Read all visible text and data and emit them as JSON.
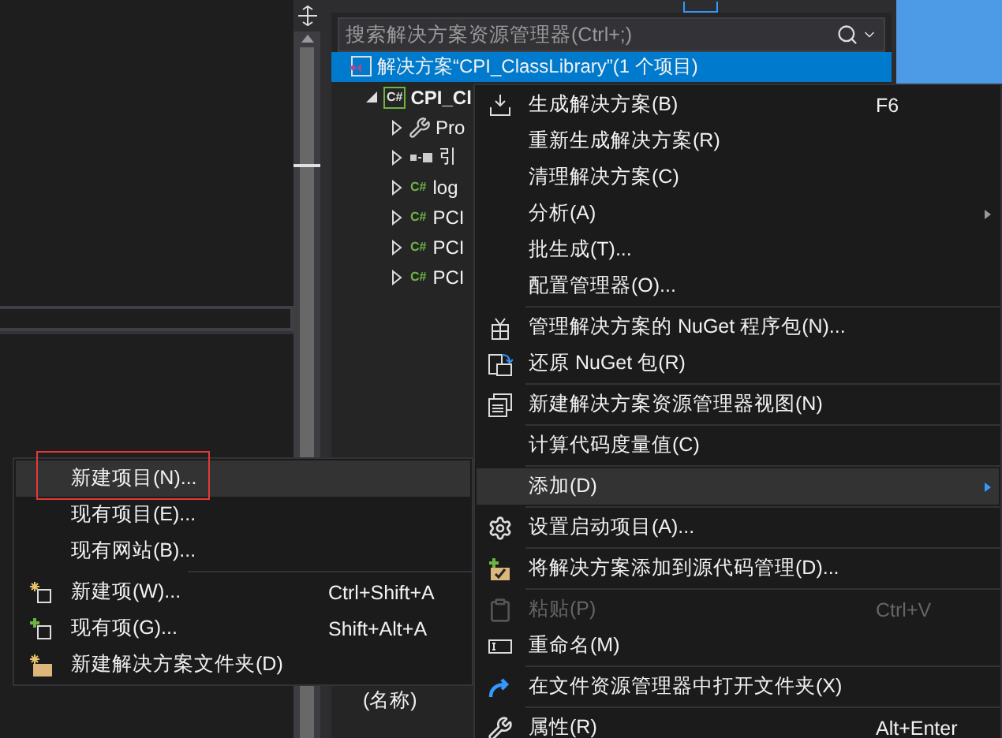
{
  "search": {
    "placeholder": "搜索解决方案资源管理器(Ctrl+;)"
  },
  "tree": [
    {
      "kind": "solution",
      "label": "解决方案“CPI_ClassLibrary”(1 个项目)",
      "selected": true,
      "children": [
        {
          "kind": "project",
          "badge": "C#",
          "label": "CPI_Cl",
          "selected": false,
          "expanded": true,
          "children": [
            {
              "kind": "properties",
              "label": "Pro",
              "selected": false,
              "expanded": false
            },
            {
              "kind": "references",
              "label": "引",
              "selected": false,
              "expanded": false
            },
            {
              "kind": "file",
              "badge": "C#",
              "label": "log",
              "selected": false,
              "expanded": false
            },
            {
              "kind": "file",
              "badge": "C#",
              "label": "PCI",
              "selected": false,
              "expanded": false
            },
            {
              "kind": "file",
              "badge": "C#",
              "label": "PCI",
              "selected": false,
              "expanded": false
            },
            {
              "kind": "file",
              "badge": "C#",
              "label": "PCI",
              "selected": false,
              "expanded": false
            }
          ]
        }
      ]
    }
  ],
  "properties": {
    "rows": [
      {
        "name": "(名称)"
      }
    ]
  },
  "context_menu": {
    "items": [
      {
        "kind": "item",
        "label": "生成解决方案(B)",
        "shortcut": "F6",
        "selected": false,
        "disabled": false,
        "submenu": false
      },
      {
        "kind": "item",
        "label": "重新生成解决方案(R)",
        "selected": false,
        "disabled": false,
        "submenu": false
      },
      {
        "kind": "item",
        "label": "清理解决方案(C)",
        "selected": false,
        "disabled": false,
        "submenu": false
      },
      {
        "kind": "item",
        "label": "分析(A)",
        "selected": false,
        "disabled": false,
        "submenu": true
      },
      {
        "kind": "item",
        "label": "批生成(T)...",
        "selected": false,
        "disabled": false,
        "submenu": false
      },
      {
        "kind": "item",
        "label": "配置管理器(O)...",
        "selected": false,
        "disabled": false,
        "submenu": false
      },
      {
        "kind": "separator"
      },
      {
        "kind": "item",
        "label": "管理解决方案的 NuGet 程序包(N)...",
        "selected": false,
        "disabled": false,
        "submenu": false
      },
      {
        "kind": "item",
        "label": "还原 NuGet 包(R)",
        "selected": false,
        "disabled": false,
        "submenu": false
      },
      {
        "kind": "separator"
      },
      {
        "kind": "item",
        "label": "新建解决方案资源管理器视图(N)",
        "selected": false,
        "disabled": false,
        "submenu": false
      },
      {
        "kind": "separator"
      },
      {
        "kind": "item",
        "label": "计算代码度量值(C)",
        "selected": false,
        "disabled": false,
        "submenu": false
      },
      {
        "kind": "separator"
      },
      {
        "kind": "item",
        "label": "添加(D)",
        "selected": true,
        "disabled": false,
        "submenu": true
      },
      {
        "kind": "separator"
      },
      {
        "kind": "item",
        "label": "设置启动项目(A)...",
        "selected": false,
        "disabled": false,
        "submenu": false
      },
      {
        "kind": "separator"
      },
      {
        "kind": "item",
        "label": "将解决方案添加到源代码管理(D)...",
        "selected": false,
        "disabled": false,
        "submenu": false
      },
      {
        "kind": "separator"
      },
      {
        "kind": "item",
        "label": "粘贴(P)",
        "shortcut": "Ctrl+V",
        "selected": false,
        "disabled": true,
        "submenu": false
      },
      {
        "kind": "item",
        "label": "重命名(M)",
        "selected": false,
        "disabled": false,
        "submenu": false
      },
      {
        "kind": "separator"
      },
      {
        "kind": "item",
        "label": "在文件资源管理器中打开文件夹(X)",
        "selected": false,
        "disabled": false,
        "submenu": false
      },
      {
        "kind": "separator"
      },
      {
        "kind": "item",
        "label": "属性(R)",
        "shortcut": "Alt+Enter",
        "selected": false,
        "disabled": false,
        "submenu": false
      }
    ]
  },
  "add_submenu": {
    "items": [
      {
        "kind": "item",
        "label": "新建项目(N)...",
        "selected": true,
        "disabled": false,
        "annotated": true
      },
      {
        "kind": "item",
        "label": "现有项目(E)...",
        "selected": false,
        "disabled": false,
        "annotated": false
      },
      {
        "kind": "item",
        "label": "现有网站(B)...",
        "selected": false,
        "disabled": false,
        "annotated": false
      },
      {
        "kind": "separator"
      },
      {
        "kind": "item",
        "label": "新建项(W)...",
        "shortcut": "Ctrl+Shift+A",
        "selected": false,
        "disabled": false,
        "annotated": false
      },
      {
        "kind": "item",
        "label": "现有项(G)...",
        "shortcut": "Shift+Alt+A",
        "selected": false,
        "disabled": false,
        "annotated": false
      },
      {
        "kind": "item",
        "label": "新建解决方案文件夹(D)",
        "selected": false,
        "disabled": false,
        "annotated": false
      }
    ]
  }
}
